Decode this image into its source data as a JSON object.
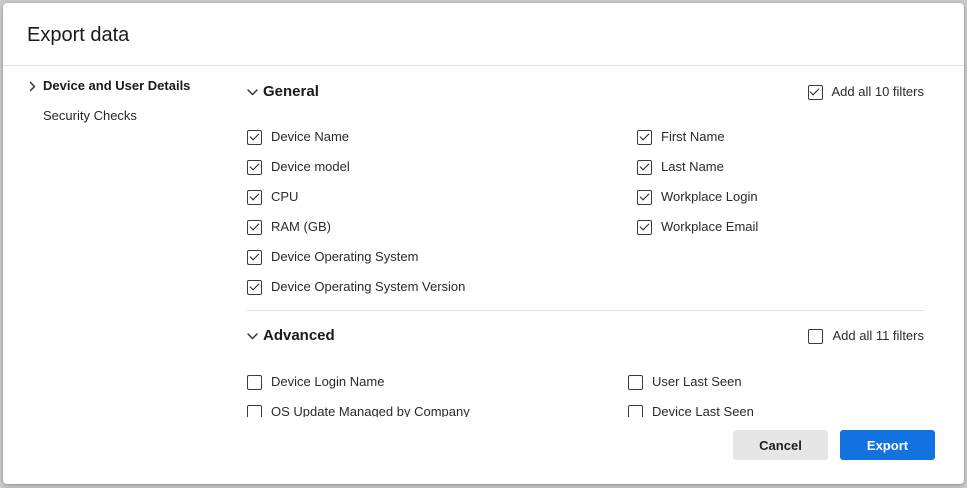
{
  "dialog": {
    "title": "Export data"
  },
  "sidebar": {
    "items": [
      {
        "label": "Device and User Details",
        "selected": true,
        "icon": "chevron-right-icon"
      },
      {
        "label": "Security Checks",
        "selected": false
      }
    ]
  },
  "sections": [
    {
      "title": "General",
      "expanded": true,
      "toggle_icon": "chevron-down-icon",
      "add_all": {
        "label": "Add all 10 filters",
        "checked": true
      },
      "columns": [
        [
          {
            "label": "Device Name",
            "checked": true
          },
          {
            "label": "Device model",
            "checked": true
          },
          {
            "label": "CPU",
            "checked": true
          },
          {
            "label": "RAM (GB)",
            "checked": true
          },
          {
            "label": "Device Operating System",
            "checked": true
          },
          {
            "label": "Device Operating System Version",
            "checked": true
          }
        ],
        [
          {
            "label": "First Name",
            "checked": true
          },
          {
            "label": "Last Name",
            "checked": true
          },
          {
            "label": "Workplace Login",
            "checked": true
          },
          {
            "label": "Workplace Email",
            "checked": true
          }
        ]
      ]
    },
    {
      "title": "Advanced",
      "expanded": true,
      "toggle_icon": "chevron-down-icon",
      "add_all": {
        "label": "Add all 11 filters",
        "checked": false
      },
      "columns": [
        [
          {
            "label": "Device Login Name",
            "checked": false
          },
          {
            "label": "OS Update Managed by Company",
            "checked": false
          }
        ],
        [
          {
            "label": "User Last Seen",
            "checked": false
          },
          {
            "label": "Device Last Seen",
            "checked": false
          }
        ]
      ]
    }
  ],
  "footer": {
    "cancel_label": "Cancel",
    "export_label": "Export"
  },
  "colors": {
    "primary_button": "#1272df",
    "secondary_button": "#e6e6e6",
    "divider": "#e2e2e2"
  }
}
